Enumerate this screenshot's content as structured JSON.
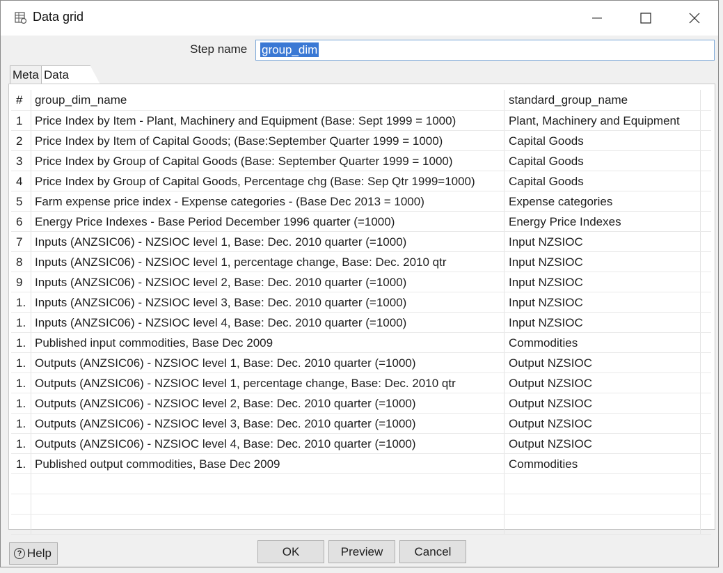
{
  "window": {
    "title": "Data grid"
  },
  "step": {
    "label": "Step name",
    "value": "group_dim"
  },
  "tabs": [
    {
      "label": "Meta"
    },
    {
      "label": "Data"
    }
  ],
  "grid": {
    "headers": {
      "num": "#",
      "col1": "group_dim_name",
      "col2": "standard_group_name"
    },
    "rows": [
      {
        "num": "1",
        "col1": "Price Index by Item - Plant, Machinery and Equipment (Base: Sept 1999 = 1000)",
        "col2": "Plant, Machinery and Equipment"
      },
      {
        "num": "2",
        "col1": "Price Index by Item of Capital Goods; (Base:September Quarter 1999 = 1000)",
        "col2": "Capital Goods"
      },
      {
        "num": "3",
        "col1": "Price Index by Group of Capital Goods (Base: September Quarter 1999 = 1000)",
        "col2": "Capital Goods"
      },
      {
        "num": "4",
        "col1": "Price Index by Group of Capital Goods, Percentage chg (Base: Sep Qtr 1999=1000)",
        "col2": "Capital Goods"
      },
      {
        "num": "5",
        "col1": "Farm expense price index - Expense categories -  (Base Dec 2013 = 1000)",
        "col2": "Expense categories"
      },
      {
        "num": "6",
        "col1": "Energy Price Indexes - Base Period December 1996 quarter (=1000)",
        "col2": "Energy Price Indexes"
      },
      {
        "num": "7",
        "col1": "Inputs (ANZSIC06) - NZSIOC level 1, Base: Dec. 2010 quarter (=1000)",
        "col2": "Input NZSIOC"
      },
      {
        "num": "8",
        "col1": "Inputs (ANZSIC06) - NZSIOC level 1, percentage change, Base: Dec. 2010 qtr",
        "col2": "Input NZSIOC"
      },
      {
        "num": "9",
        "col1": "Inputs (ANZSIC06) - NZSIOC level 2, Base: Dec. 2010 quarter (=1000)",
        "col2": "Input NZSIOC"
      },
      {
        "num": "1.",
        "col1": "Inputs (ANZSIC06) - NZSIOC level 3, Base: Dec. 2010 quarter (=1000)",
        "col2": "Input NZSIOC"
      },
      {
        "num": "1.",
        "col1": "Inputs (ANZSIC06) - NZSIOC level 4, Base: Dec. 2010 quarter (=1000)",
        "col2": "Input NZSIOC"
      },
      {
        "num": "1.",
        "col1": "Published input commodities, Base Dec 2009",
        "col2": "Commodities"
      },
      {
        "num": "1.",
        "col1": "Outputs (ANZSIC06) - NZSIOC level 1, Base: Dec. 2010 quarter (=1000)",
        "col2": "Output NZSIOC"
      },
      {
        "num": "1.",
        "col1": "Outputs (ANZSIC06) - NZSIOC level 1, percentage change, Base: Dec. 2010 qtr",
        "col2": "Output NZSIOC"
      },
      {
        "num": "1.",
        "col1": "Outputs (ANZSIC06) - NZSIOC level 2, Base: Dec. 2010 quarter (=1000)",
        "col2": "Output NZSIOC"
      },
      {
        "num": "1.",
        "col1": "Outputs (ANZSIC06) - NZSIOC level 3, Base: Dec. 2010 quarter (=1000)",
        "col2": "Output NZSIOC"
      },
      {
        "num": "1.",
        "col1": "Outputs (ANZSIC06) - NZSIOC level 4, Base: Dec. 2010 quarter (=1000)",
        "col2": "Output NZSIOC"
      },
      {
        "num": "1.",
        "col1": "Published output commodities, Base Dec 2009",
        "col2": "Commodities"
      }
    ]
  },
  "buttons": {
    "help": "Help",
    "ok": "OK",
    "preview": "Preview",
    "cancel": "Cancel"
  }
}
